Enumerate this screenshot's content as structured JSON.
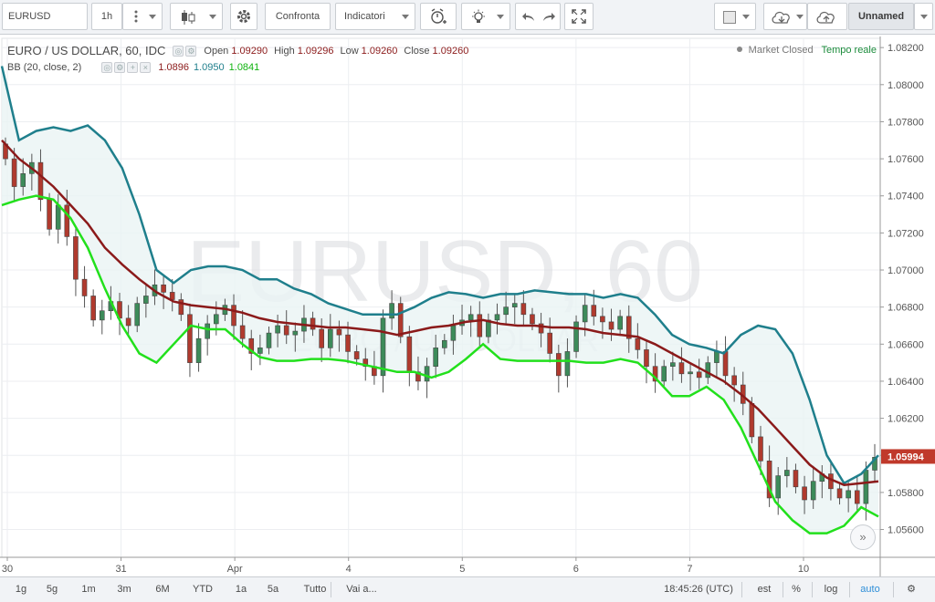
{
  "toolbar": {
    "symbol": "EURUSD",
    "interval": "1h",
    "compare_label": "Confronta",
    "indicators_label": "Indicatori",
    "layout_name": "Unnamed",
    "icons": [
      "more-vertical-icon",
      "candlestick-icon",
      "gear-icon",
      "alert-icon",
      "lightbulb-icon",
      "undo-icon",
      "redo-icon",
      "fullscreen-icon",
      "color-square-icon",
      "cloud-download-icon",
      "cloud-upload-icon"
    ]
  },
  "legend": {
    "title": "EURO / US DOLLAR, 60, IDC",
    "open_label": "Open",
    "open": "1.09290",
    "high_label": "High",
    "high": "1.09296",
    "low_label": "Low",
    "low": "1.09260",
    "close_label": "Close",
    "close": "1.09260",
    "bb_label": "BB (20, close, 2)",
    "bb_mid": "1.0896",
    "bb_upper": "1.0950",
    "bb_lower": "1.0841"
  },
  "status": {
    "market": "Market Closed",
    "realtime": "Tempo reale"
  },
  "watermark": {
    "symbol": "EURUSD, 60",
    "name": "EURO / US DOLLAR"
  },
  "colors": {
    "up_candle": "#3d8b5a",
    "down_candle": "#b03a2e",
    "bb_basis": "#8b1a1a",
    "bb_upper": "#1f7f8c",
    "bb_lower": "#22e01c",
    "bb_fill": "#eaf4f4",
    "price_tag": "#c0392b",
    "accent": "#2f8fd8"
  },
  "bottombar": {
    "ranges": [
      "1g",
      "5g",
      "1m",
      "3m",
      "6M",
      "YTD",
      "1a",
      "5a",
      "Tutto"
    ],
    "goto_label": "Vai a...",
    "clock": "18:45:26 (UTC)",
    "est": "est",
    "percent": "%",
    "log": "log",
    "auto": "auto"
  },
  "chart_data": {
    "type": "candlestick",
    "title": "EURO / US DOLLAR, 60, IDC",
    "x_tick_labels": [
      "30",
      "31",
      "Apr",
      "4",
      "5",
      "6",
      "7",
      "10"
    ],
    "y_tick_labels": [
      "1.08200",
      "1.08000",
      "1.07800",
      "1.07600",
      "1.07400",
      "1.07200",
      "1.07000",
      "1.06800",
      "1.06600",
      "1.06400",
      "1.06200",
      "1.06000",
      "1.05800",
      "1.05600"
    ],
    "ylim": [
      1.0545,
      1.0825
    ],
    "last_price": "1.05994",
    "grid": true,
    "indicator": "Bollinger Bands (20, close, 2)",
    "bb_upper": [
      1.081,
      1.077,
      1.0775,
      1.0777,
      1.0775,
      1.0778,
      1.077,
      1.0755,
      1.073,
      1.07,
      1.0693,
      1.07,
      1.0702,
      1.0702,
      1.07,
      1.0695,
      1.0695,
      1.069,
      1.0687,
      1.0682,
      1.0679,
      1.0676,
      1.0676,
      1.0676,
      1.068,
      1.0685,
      1.0688,
      1.0687,
      1.0685,
      1.0687,
      1.0687,
      1.0689,
      1.0688,
      1.0687,
      1.0687,
      1.0685,
      1.0687,
      1.0685,
      1.0676,
      1.0665,
      1.066,
      1.0658,
      1.0655,
      1.0665,
      1.067,
      1.0668,
      1.0655,
      1.063,
      1.06,
      1.0585,
      1.059,
      1.06
    ],
    "bb_basis": [
      1.077,
      1.076,
      1.0753,
      1.0745,
      1.0735,
      1.0725,
      1.0712,
      1.0703,
      1.0695,
      1.0688,
      1.0683,
      1.0681,
      1.068,
      1.0679,
      1.0677,
      1.0674,
      1.0672,
      1.0671,
      1.067,
      1.0669,
      1.0669,
      1.0668,
      1.0667,
      1.0665,
      1.0667,
      1.0669,
      1.067,
      1.0672,
      1.0673,
      1.0671,
      1.067,
      1.067,
      1.0669,
      1.0669,
      1.0668,
      1.0666,
      1.0665,
      1.0664,
      1.066,
      1.0655,
      1.065,
      1.0645,
      1.064,
      1.0633,
      1.0625,
      1.0615,
      1.0605,
      1.0595,
      1.0588,
      1.0584,
      1.0585,
      1.0586
    ],
    "bb_lower": [
      1.0735,
      1.0738,
      1.074,
      1.0738,
      1.0728,
      1.0712,
      1.069,
      1.067,
      1.0655,
      1.065,
      1.066,
      1.067,
      1.0668,
      1.0668,
      1.066,
      1.0653,
      1.0651,
      1.0651,
      1.0652,
      1.0652,
      1.0651,
      1.0649,
      1.0647,
      1.0645,
      1.0645,
      1.0642,
      1.0645,
      1.0652,
      1.066,
      1.0652,
      1.0651,
      1.0651,
      1.0651,
      1.0651,
      1.065,
      1.065,
      1.0652,
      1.065,
      1.0642,
      1.0632,
      1.0632,
      1.0637,
      1.063,
      1.0615,
      1.0595,
      1.0575,
      1.0565,
      1.0558,
      1.0558,
      1.0562,
      1.0572,
      1.0567
    ],
    "closes": [
      1.076,
      1.0745,
      1.0752,
      1.0758,
      1.0738,
      1.0722,
      1.0735,
      1.0718,
      1.0695,
      1.0686,
      1.0673,
      1.0678,
      1.0683,
      1.0674,
      1.067,
      1.0682,
      1.0686,
      1.0692,
      1.0688,
      1.0684,
      1.0676,
      1.065,
      1.0663,
      1.0671,
      1.0676,
      1.0681,
      1.067,
      1.0663,
      1.0655,
      1.0658,
      1.0666,
      1.067,
      1.0665,
      1.0667,
      1.0674,
      1.0668,
      1.0658,
      1.0668,
      1.0665,
      1.0656,
      1.0652,
      1.0648,
      1.0643,
      1.0674,
      1.0682,
      1.0664,
      1.0645,
      1.064,
      1.0648,
      1.0658,
      1.0662,
      1.067,
      1.0673,
      1.0676,
      1.0664,
      1.0673,
      1.0676,
      1.068,
      1.0682,
      1.0676,
      1.0671,
      1.0666,
      1.0655,
      1.0643,
      1.0656,
      1.0672,
      1.0681,
      1.0675,
      1.0672,
      1.0668,
      1.0675,
      1.0663,
      1.0657,
      1.0648,
      1.064,
      1.0648,
      1.065,
      1.0644,
      1.0645,
      1.0642,
      1.065,
      1.0656,
      1.0643,
      1.0638,
      1.0628,
      1.061,
      1.0597,
      1.0577,
      1.0589,
      1.0592,
      1.0583,
      1.0576,
      1.0586,
      1.059,
      1.0582,
      1.0577,
      1.0581,
      1.0574,
      1.0592,
      1.0599
    ]
  }
}
